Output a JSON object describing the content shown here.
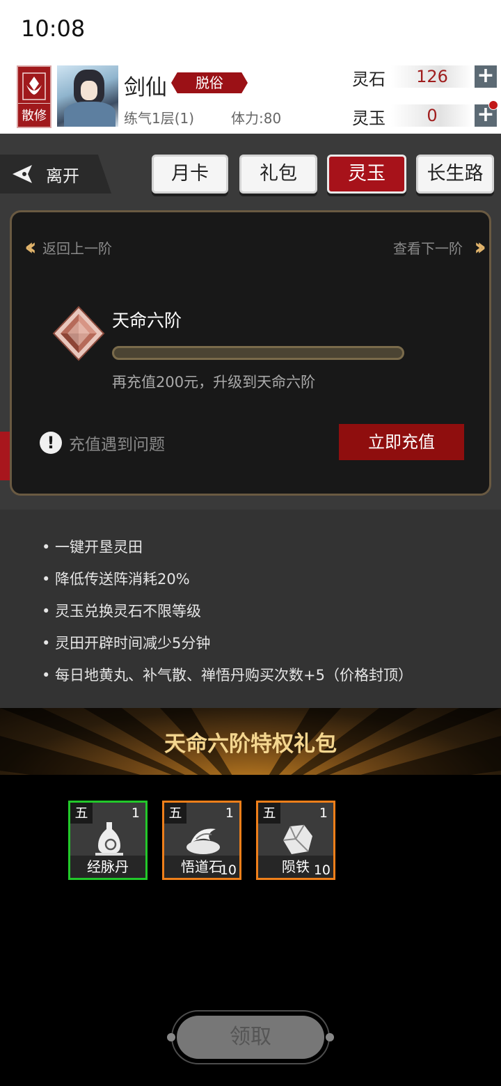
{
  "status_bar": {
    "time": "10:08"
  },
  "header": {
    "sect_badge": "散修",
    "player_name": "剑仙",
    "realm_badge": "脱俗",
    "cultivation": "练气1层(1)",
    "stamina": "体力:80",
    "currencies": [
      {
        "label": "灵石",
        "value": "126"
      },
      {
        "label": "灵玉",
        "value": "0"
      }
    ],
    "plus_icon": "plus-icon"
  },
  "nav": {
    "leave_label": "离开",
    "tabs": [
      {
        "label": "月卡",
        "active": false
      },
      {
        "label": "礼包",
        "active": false
      },
      {
        "label": "灵玉",
        "active": true
      },
      {
        "label": "长生路",
        "active": false
      }
    ]
  },
  "vip_card": {
    "prev_label": "返回上一阶",
    "next_label": "查看下一阶",
    "rank_title": "天命六阶",
    "progress": 0,
    "upgrade_hint": "再充值200元，升级到天命六阶",
    "issue_label": "充值遇到问题",
    "recharge_label": "立即充值"
  },
  "perks": [
    "• 一键开垦灵田",
    "• 降低传送阵消耗20%",
    "• 灵玉兑换灵石不限等级",
    "• 灵田开辟时间减少5分钟",
    "• 每日地黄丸、补气散、禅悟丹购买次数+5（价格封顶）"
  ],
  "gift": {
    "title": "天命六阶特权礼包",
    "items": [
      {
        "grade": "五",
        "qty": "1",
        "name": "经脉丹",
        "count": "",
        "border": "#22c82a"
      },
      {
        "grade": "五",
        "qty": "1",
        "name": "悟道石",
        "count": "10",
        "border": "#ef7f1a"
      },
      {
        "grade": "五",
        "qty": "1",
        "name": "陨铁",
        "count": "10",
        "border": "#ef7f1a"
      }
    ],
    "claim_label": "领取"
  }
}
